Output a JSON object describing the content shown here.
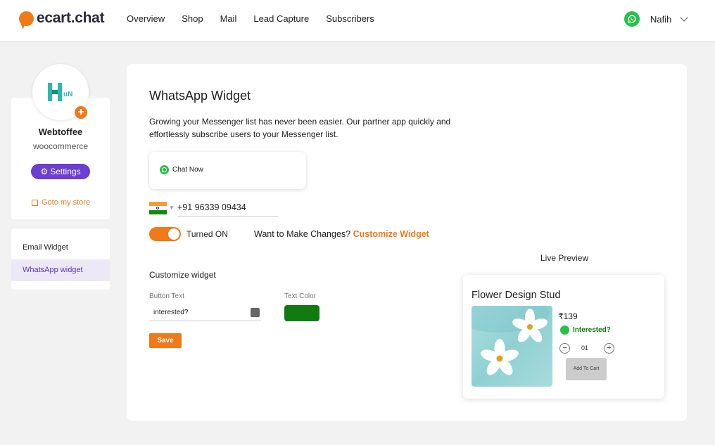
{
  "header": {
    "brand": "ecart.chat",
    "nav": [
      "Overview",
      "Shop",
      "Mail",
      "Lead Capture",
      "Subscribers"
    ],
    "user_name": "Nafih"
  },
  "sidebar": {
    "logo_text": "HuN",
    "store_name": "Webtoffee",
    "store_type": "woocommerce",
    "settings_label": "Settings",
    "goto_store_label": "Goto my store",
    "menu": [
      {
        "label": "Email Widget",
        "active": false
      },
      {
        "label": "WhatsApp widget",
        "active": true
      }
    ]
  },
  "main": {
    "title": "WhatsApp Widget",
    "description": "Growing your Messenger list has never been easier. Our partner app quickly and effortlessly subscribe users to your Messenger list.",
    "chat_now_label": "Chat Now",
    "phone": "+91 96339 09434",
    "toggle_label": "Turned ON",
    "toggle_on": true,
    "changes_prompt": "Want to Make Changes?",
    "customize_link": "Customize Widget",
    "customize_title": "Customize widget",
    "button_text_label": "Button Text",
    "button_text_value": "interested?",
    "text_color_label": "Text Color",
    "text_color_value": "#0f7b0f",
    "save_label": "Save"
  },
  "preview": {
    "label": "Live Preview",
    "product_title": "Flower Design Stud",
    "price": "₹139",
    "interested_label": "Interested?",
    "quantity": "01",
    "add_to_cart": "Add To Cart"
  },
  "colors": {
    "accent": "#f07918",
    "purple": "#6b3fd1",
    "whatsapp": "#27c04b"
  }
}
